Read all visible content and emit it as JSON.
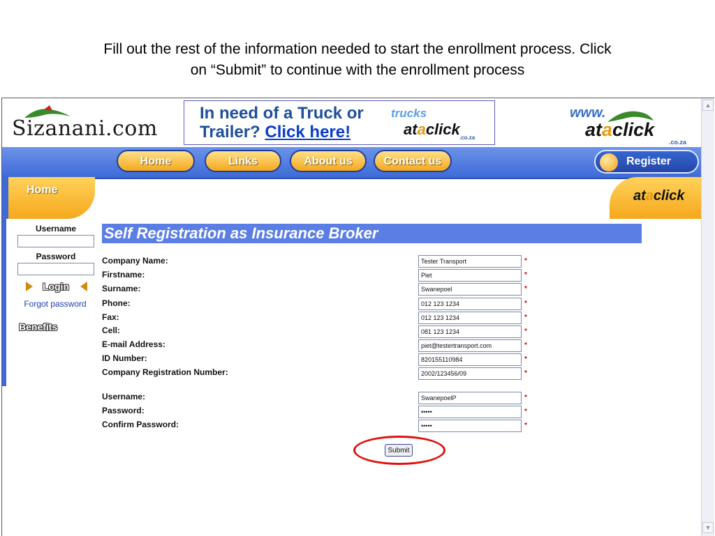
{
  "caption": {
    "line1": "Fill out the rest of the information needed to start the enrollment process. Click",
    "line2": "on “Submit” to continue with the enrollment process"
  },
  "header": {
    "logo_text": "Sizanani.com",
    "banner": {
      "line1": "In need of a Truck or",
      "line2_prefix": "Trailer?",
      "line2_link": "Click here!",
      "logo_trucks": "trucks",
      "logo_at": "at",
      "logo_a": "a",
      "logo_click": "click",
      "logo_coza": ".co.za"
    },
    "right_logo": {
      "www": "www.",
      "at": "at",
      "a": "a",
      "click": "click",
      "coza": ".co.za"
    }
  },
  "nav": {
    "items": [
      {
        "label": "Home"
      },
      {
        "label": "Links"
      },
      {
        "label": "About us"
      },
      {
        "label": "Contact us"
      }
    ],
    "register_label": "Register"
  },
  "tabs": {
    "home_label": "Home",
    "right_logo": {
      "at": "at",
      "a": "a",
      "click": "click"
    }
  },
  "colors": {
    "nav_blue": "#3d6ad8",
    "tab_orange": "#f5a81c",
    "title_blue": "#5b7ee5",
    "required_red": "#d00000",
    "highlight_red": "#e01010"
  },
  "login": {
    "username_label": "Username",
    "password_label": "Password",
    "login_button": "Login",
    "forgot_link": "Forgot password",
    "benefits_label": "Benefits"
  },
  "form": {
    "title": "Self Registration as Insurance Broker",
    "fields": [
      {
        "label": "Company Name:",
        "value": "Tester Transport"
      },
      {
        "label": "Firstname:",
        "value": "Piet"
      },
      {
        "label": "Surname:",
        "value": "Swanepoel"
      },
      {
        "label": "Phone:",
        "value": "012 123 1234"
      },
      {
        "label": "Fax:",
        "value": "012 123 1234"
      },
      {
        "label": "Cell:",
        "value": "081 123 1234"
      },
      {
        "label": "E-mail Address:",
        "value": "piet@testertransport.com"
      },
      {
        "label": "ID Number:",
        "value": "820155110984"
      },
      {
        "label": "Company Registration Number:",
        "value": "2002/123456/09"
      }
    ],
    "account_fields": [
      {
        "label": "Username:",
        "value": "SwanepoelP"
      },
      {
        "label": "Password:",
        "value": "•••••"
      },
      {
        "label": "Confirm Password:",
        "value": "•••••"
      }
    ],
    "required_marker": "*",
    "submit_label": "Submit"
  }
}
